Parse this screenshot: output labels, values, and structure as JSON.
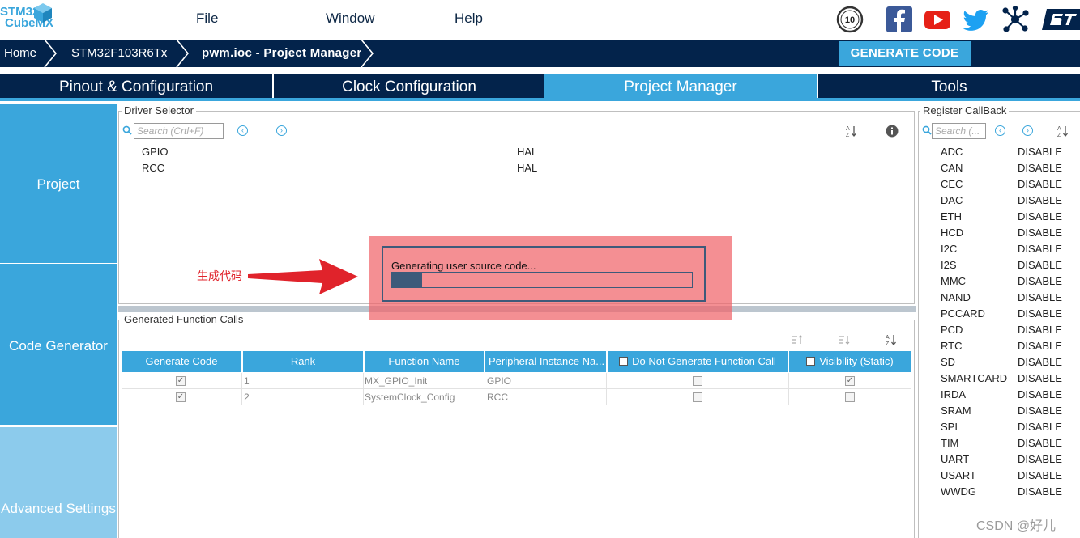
{
  "app": {
    "logo_line1": "STM32",
    "logo_line2": "CubeMX",
    "menu": [
      "File",
      "Window",
      "Help"
    ],
    "social_icons": [
      "anniversary-badge-icon",
      "facebook-icon",
      "youtube-icon",
      "twitter-icon",
      "network-icon",
      "st-logo-icon"
    ],
    "badge_text": "10"
  },
  "breadcrumb": [
    "Home",
    "STM32F103R6Tx",
    "pwm.ioc - Project Manager"
  ],
  "generate_button": "GENERATE CODE",
  "tabs": [
    "Pinout & Configuration",
    "Clock Configuration",
    "Project Manager",
    "Tools"
  ],
  "active_tab": "Project Manager",
  "left_nav": [
    "Project",
    "Code Generator",
    "Advanced Settings"
  ],
  "driver_selector": {
    "legend": "Driver Selector",
    "search_placeholder": "Search (Crtl+F)",
    "rows": [
      {
        "name": "GPIO",
        "driver": "HAL"
      },
      {
        "name": "RCC",
        "driver": "HAL"
      }
    ]
  },
  "function_calls": {
    "legend": "Generated Function Calls",
    "columns": [
      "Generate Code",
      "Rank",
      "Function Name",
      "Peripheral Instance Na...",
      "Do Not Generate Function Call",
      "Visibility (Static)"
    ],
    "rows": [
      {
        "generate": true,
        "rank": "1",
        "function": "MX_GPIO_Init",
        "instance": "GPIO",
        "no_generate": false,
        "visibility": true
      },
      {
        "generate": true,
        "rank": "2",
        "function": "SystemClock_Config",
        "instance": "RCC",
        "no_generate": false,
        "visibility": false
      }
    ]
  },
  "register_callback": {
    "legend": "Register CallBack",
    "search_placeholder": "Search (...",
    "items": [
      {
        "name": "ADC",
        "value": "DISABLE"
      },
      {
        "name": "CAN",
        "value": "DISABLE"
      },
      {
        "name": "CEC",
        "value": "DISABLE"
      },
      {
        "name": "DAC",
        "value": "DISABLE"
      },
      {
        "name": "ETH",
        "value": "DISABLE"
      },
      {
        "name": "HCD",
        "value": "DISABLE"
      },
      {
        "name": "I2C",
        "value": "DISABLE"
      },
      {
        "name": "I2S",
        "value": "DISABLE"
      },
      {
        "name": "MMC",
        "value": "DISABLE"
      },
      {
        "name": "NAND",
        "value": "DISABLE"
      },
      {
        "name": "PCCARD",
        "value": "DISABLE"
      },
      {
        "name": "PCD",
        "value": "DISABLE"
      },
      {
        "name": "RTC",
        "value": "DISABLE"
      },
      {
        "name": "SD",
        "value": "DISABLE"
      },
      {
        "name": "SMARTCARD",
        "value": "DISABLE"
      },
      {
        "name": "IRDA",
        "value": "DISABLE"
      },
      {
        "name": "SRAM",
        "value": "DISABLE"
      },
      {
        "name": "SPI",
        "value": "DISABLE"
      },
      {
        "name": "TIM",
        "value": "DISABLE"
      },
      {
        "name": "UART",
        "value": "DISABLE"
      },
      {
        "name": "USART",
        "value": "DISABLE"
      },
      {
        "name": "WWDG",
        "value": "DISABLE"
      }
    ]
  },
  "progress_dialog": {
    "message": "Generating user source code...",
    "progress_fraction": 0.1
  },
  "annotation": {
    "text": "生成代码"
  },
  "watermark": "CSDN @好儿",
  "colors": {
    "navy": "#03234b",
    "accent": "#3aa6dc",
    "overlay_red": "#f06469",
    "annotation_red": "#e0232b"
  }
}
